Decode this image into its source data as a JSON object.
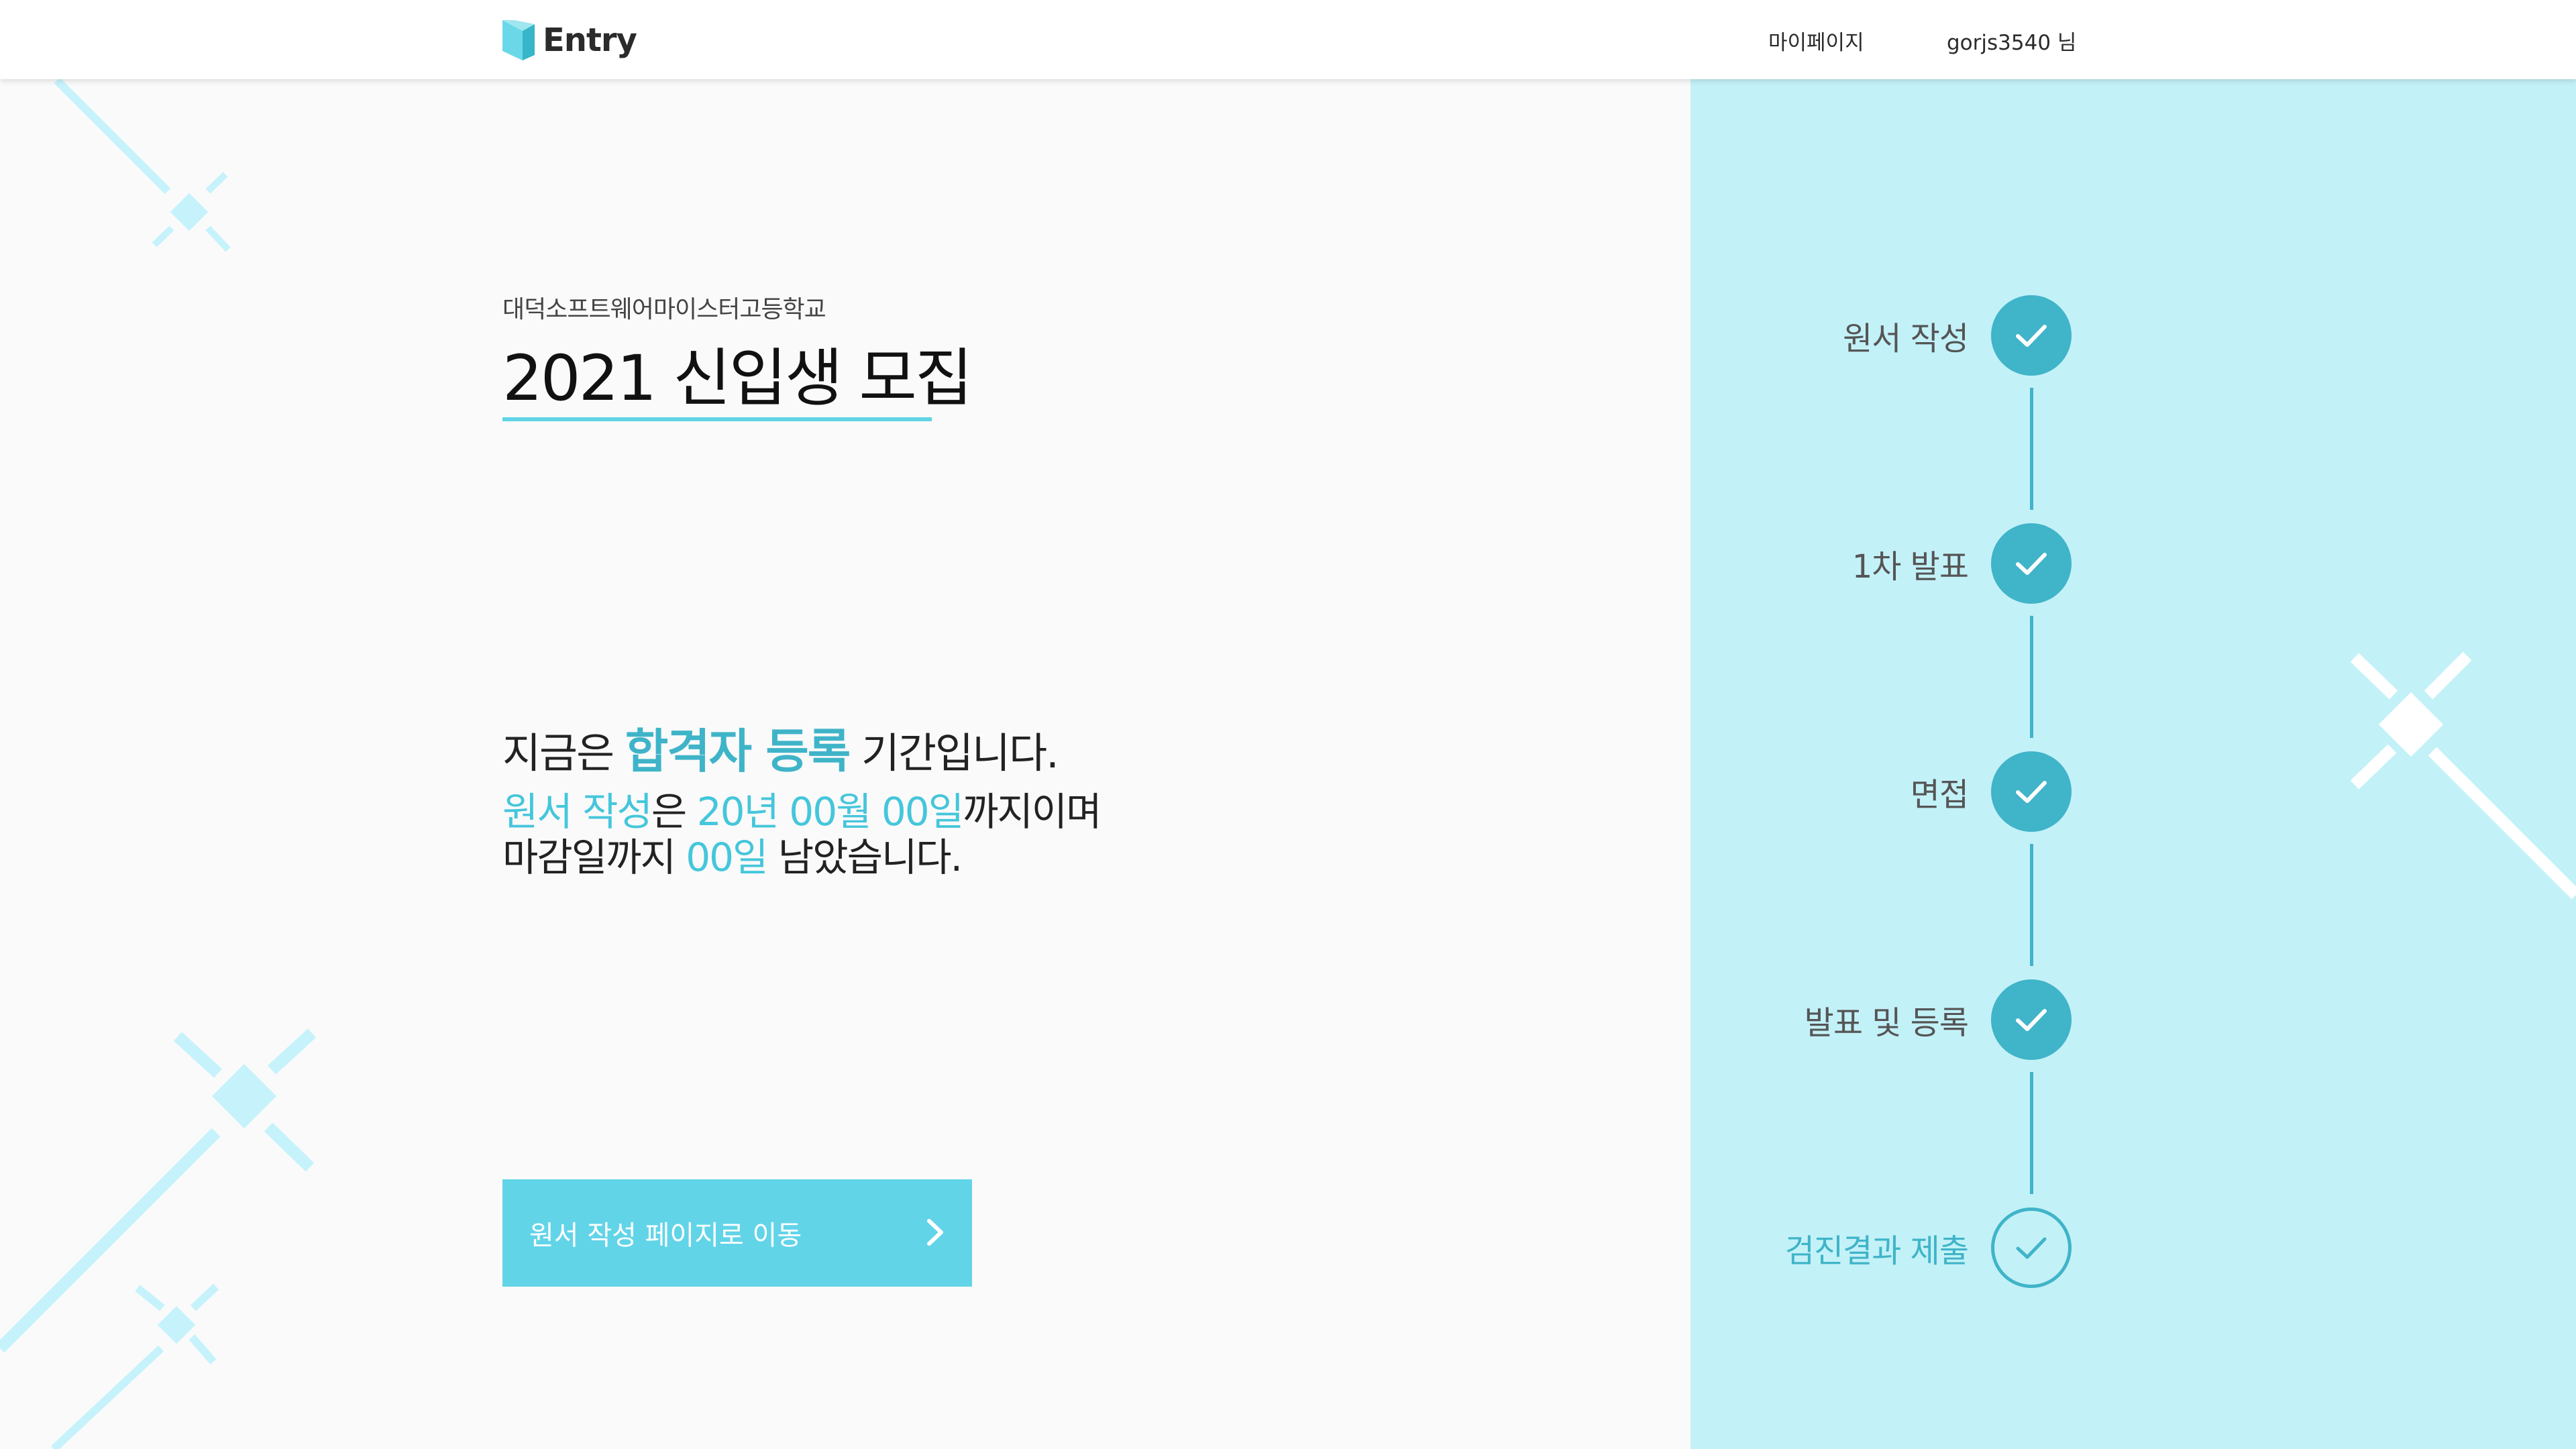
{
  "header": {
    "logo_text": "Entry",
    "mypage_label": "마이페이지",
    "user_label": "gorjs3540 님"
  },
  "hero": {
    "school_name": "대덕소프트웨어마이스터고등학교",
    "title": "2021 신입생 모집"
  },
  "status": {
    "prefix": "지금은",
    "period_name": "합격자 등록",
    "suffix": "기간입니다.",
    "deadline_line1": {
      "stage": "원서 작성",
      "josa": "은",
      "date": "20년 00월 00일",
      "tail": "까지이며"
    },
    "deadline_line2": {
      "lead": "마감일까지",
      "days": "00일",
      "tail": "남았습니다."
    }
  },
  "cta": {
    "label": "원서 작성 페이지로 이동"
  },
  "steps": [
    {
      "label": "원서 작성",
      "state": "done"
    },
    {
      "label": "1차 발표",
      "state": "done"
    },
    {
      "label": "면접",
      "state": "done"
    },
    {
      "label": "발표 및 등록",
      "state": "done"
    },
    {
      "label": "검진결과 제출",
      "state": "current"
    }
  ],
  "colors": {
    "accent": "#62d4e8",
    "accent_dark": "#40b4c8",
    "highlight_text": "#3fb4c8",
    "panel_bg": "#c3f1f8",
    "page_bg": "#fafafa",
    "decoration": "#c6f3fb"
  },
  "icons": {
    "logo": "entry-logo-icon",
    "button_arrow": "chevron-right-icon",
    "step_mark": "check-icon"
  }
}
